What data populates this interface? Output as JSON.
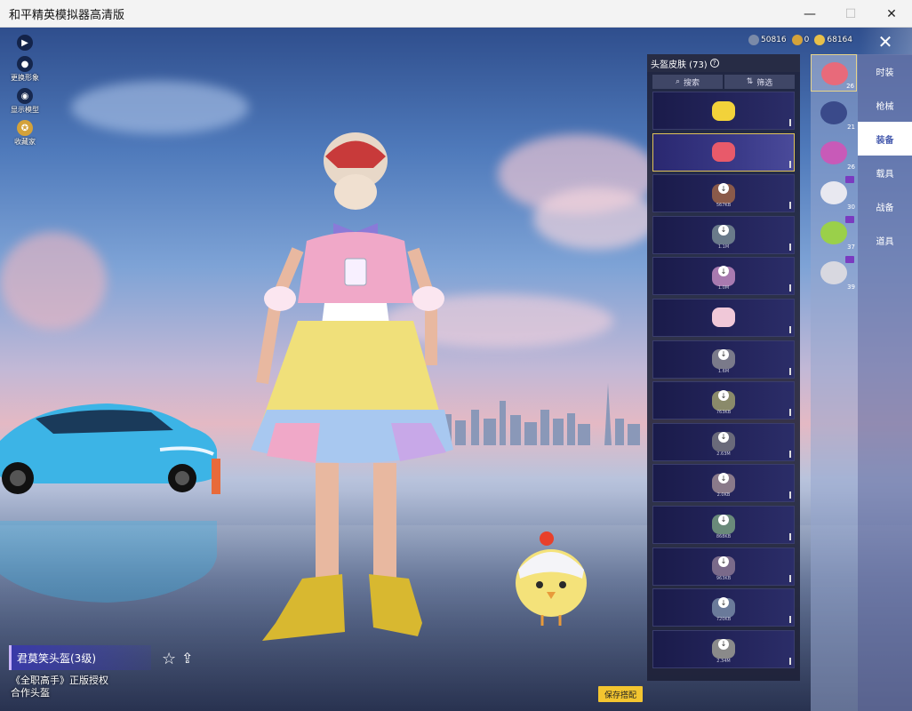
{
  "window": {
    "title": "和平精英模拟器高清版",
    "minimize": "—",
    "maximize": "☐",
    "close": "✕"
  },
  "sidetools": [
    {
      "icon": "play-icon",
      "glyph": "▶",
      "label": ""
    },
    {
      "icon": "avatar-icon",
      "glyph": "●",
      "label": "更换形象"
    },
    {
      "icon": "eye-icon",
      "glyph": "◉",
      "label": "显示模型"
    },
    {
      "icon": "collector-icon",
      "glyph": "✪",
      "label": "收藏家"
    }
  ],
  "currency": [
    {
      "icon": "coupon-icon",
      "value": "50816",
      "color": "#7a8aa8"
    },
    {
      "icon": "gold-icon",
      "value": "0",
      "color": "#d4a23a"
    },
    {
      "icon": "bp-icon",
      "value": "68164",
      "color": "#e8c04a"
    }
  ],
  "game_close": "✕",
  "item": {
    "name": "君莫笑头盔(3级)",
    "auth_line1": "《全职高手》正版授权",
    "auth_line2": "合作头盔",
    "favorite": "☆",
    "share": "⇪",
    "save": "保存搭配"
  },
  "panel": {
    "title": "头盔皮肤 (73)",
    "help": "?",
    "search": "搜索",
    "filter": "筛选"
  },
  "skins": [
    {
      "size": "",
      "color": "#f2d23a",
      "download": false,
      "selected": false
    },
    {
      "size": "",
      "color": "#e85a6a",
      "download": false,
      "selected": true
    },
    {
      "size": "567KB",
      "color": "#8a5a4a",
      "download": true,
      "selected": false
    },
    {
      "size": "1.1M",
      "color": "#6a7a8a",
      "download": true,
      "selected": false
    },
    {
      "size": "1.0M",
      "color": "#a87ab0",
      "download": true,
      "selected": false
    },
    {
      "size": "",
      "color": "#f0c8d8",
      "download": false,
      "selected": false
    },
    {
      "size": "1.6M",
      "color": "#7a7a8a",
      "download": true,
      "selected": false
    },
    {
      "size": "763KB",
      "color": "#8a8a6a",
      "download": true,
      "selected": false
    },
    {
      "size": "2.63M",
      "color": "#6a6a7a",
      "download": true,
      "selected": false
    },
    {
      "size": "2.0KB",
      "color": "#8a7a8a",
      "download": true,
      "selected": false
    },
    {
      "size": "868KB",
      "color": "#6a8a7a",
      "download": true,
      "selected": false
    },
    {
      "size": "963KB",
      "color": "#7a6a8a",
      "download": true,
      "selected": false
    },
    {
      "size": "720KB",
      "color": "#6a7a9a",
      "download": true,
      "selected": false
    },
    {
      "size": "2.34M",
      "color": "#8a8a8a",
      "download": true,
      "selected": false
    }
  ],
  "preview": [
    {
      "num": "26",
      "color": "#e86a7a",
      "badge": false,
      "selected": true
    },
    {
      "num": "21",
      "color": "#3a4a8a",
      "badge": false,
      "selected": false
    },
    {
      "num": "26",
      "color": "#c85ab8",
      "badge": false,
      "selected": false
    },
    {
      "num": "30",
      "color": "#e8e8f0",
      "badge": true,
      "selected": false
    },
    {
      "num": "37",
      "color": "#9ad04a",
      "badge": true,
      "selected": false
    },
    {
      "num": "39",
      "color": "#d8d8e0",
      "badge": true,
      "selected": false
    }
  ],
  "categories": [
    {
      "label": "时装",
      "active": false
    },
    {
      "label": "枪械",
      "active": false
    },
    {
      "label": "装备",
      "active": true
    },
    {
      "label": "载具",
      "active": false
    },
    {
      "label": "战备",
      "active": false
    },
    {
      "label": "道具",
      "active": false
    }
  ]
}
